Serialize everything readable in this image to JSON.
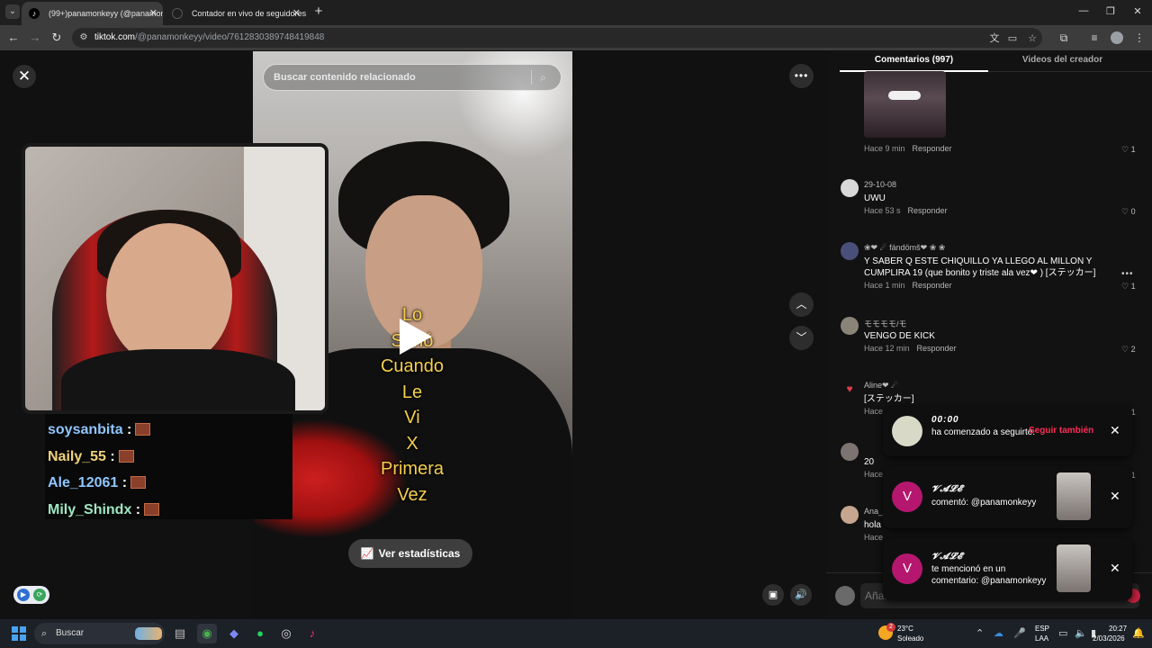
{
  "browser": {
    "tabs": [
      {
        "title": "(99+)panamonkeyy (@panamonkeyy)",
        "favicon": "tiktok-icon"
      },
      {
        "title": "Contador en vivo de seguidores"
      }
    ],
    "url_host": "tiktok.com",
    "url_path": "/@panamonkeyy/video/7612830389748419848"
  },
  "video": {
    "search_placeholder": "Buscar contenido relacionado",
    "caption_lines": [
      "Lo",
      "Sonó",
      "Cuando",
      "Le",
      "Vi",
      "X",
      "Primera",
      "Vez"
    ],
    "stats_label": "Ver estadísticas"
  },
  "stream_chat": [
    {
      "name": "soysanbita",
      "sep": " :",
      "color": "#8fc6ff"
    },
    {
      "name": "Naily_55",
      "sep": " :",
      "color": "#f0d27a"
    },
    {
      "name": "Ale_12061",
      "sep": " :",
      "color": "#8fc6ff"
    },
    {
      "name": "Mily_Shindx",
      "sep": " :",
      "color": "#9fe6c2"
    }
  ],
  "panel": {
    "tab_comments": "Comentarios (997)",
    "tab_creator": "Videos del creador",
    "reply_label": "Responder",
    "comments": [
      {
        "author": "",
        "text": "",
        "time": "Hace 9 min",
        "likes": "1"
      },
      {
        "author": "29-10-08",
        "text": "UWU",
        "time": "Hace 53 s",
        "likes": "0"
      },
      {
        "author": "❀❤ ☄ fándömš❤ ❀ ❀",
        "text": "Y SABER Q ESTE CHIQUILLO YA LLEGO AL MILLON Y CUMPLIRA 19 (que bonito y triste ala vez❤ ) [ステッカー]",
        "time": "Hace 1 min",
        "likes": "1"
      },
      {
        "author": "モモモモ/モ",
        "text": "VENGO DE KICK",
        "time": "Hace 12 min",
        "likes": "2"
      },
      {
        "author": "Aline❤ ☄",
        "text": "[ステッカー]",
        "time": "Hace",
        "likes": "1"
      },
      {
        "author": "",
        "text": "20",
        "time": "Hace",
        "likes": "1"
      },
      {
        "author": "Ana_l",
        "text": "hola",
        "time": "Hace",
        "likes": ""
      }
    ],
    "comment_placeholder": "Añadir comentario..."
  },
  "notifications": [
    {
      "name": "00:00",
      "text": "ha comenzado a seguirte.",
      "action": "Seguir también"
    },
    {
      "name": "𝓥𝓐𝓛𝓔",
      "initial": "V",
      "text": "comentó: @panamonkeyy"
    },
    {
      "name": "𝓥𝓐𝓛𝓔",
      "initial": "V",
      "text": "te mencionó en un comentario: @panamonkeyy"
    }
  ],
  "taskbar": {
    "search_label": "Buscar",
    "weather_temp": "23°C",
    "weather_desc": "Soleado",
    "lang_top": "ESP",
    "lang_bottom": "LAA",
    "time": "20:27",
    "date": "2/03/2026",
    "weather_badge": "2"
  },
  "colors": {
    "tiktok_red": "#fe2c55",
    "caption_yellow": "#f5cf4f",
    "notif_avatar": "#b5176e"
  }
}
